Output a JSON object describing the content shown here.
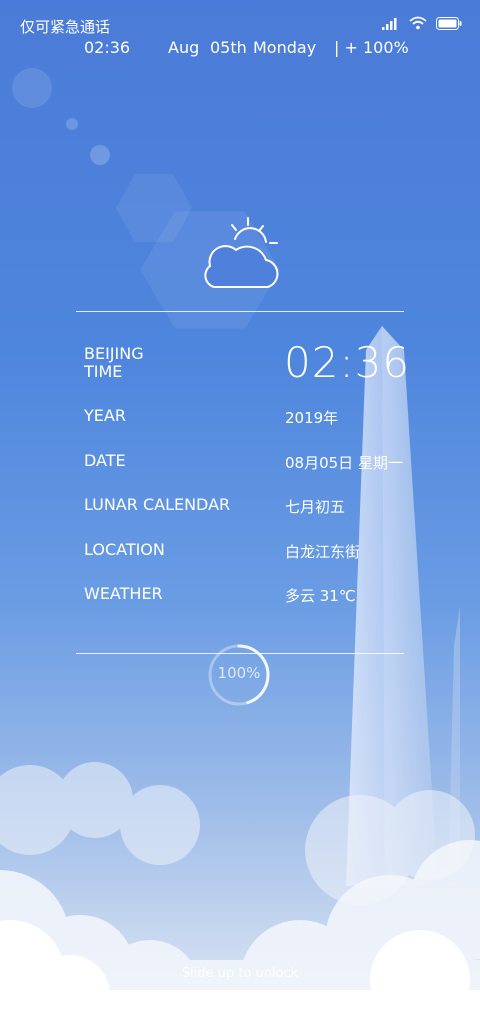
{
  "status_bar": {
    "carrier_text": "仅可紧急通话",
    "time": "02:36",
    "month": "Aug",
    "day": "05th",
    "weekday": "Monday",
    "battery_text": "| + 100%",
    "icons": [
      "signal-icon",
      "wifi-icon",
      "battery-icon"
    ]
  },
  "weather_icon": "partly-cloudy-icon",
  "info": {
    "rows": [
      {
        "label_line1": "BEIJING",
        "label_line2": "TIME",
        "value": "02:36"
      },
      {
        "label": "YEAR",
        "value": "2019年"
      },
      {
        "label": "DATE",
        "value": "08月05日 星期一"
      },
      {
        "label": "LUNAR CALENDAR",
        "value": "七月初五"
      },
      {
        "label": "LOCATION",
        "value": "白龙江东街"
      },
      {
        "label": "WEATHER",
        "value": "多云  31℃"
      }
    ]
  },
  "progress": {
    "label": "100%",
    "value": 1.0
  },
  "unlock_hint": "Slide up to unlock",
  "colors": {
    "sky_top": "#4a7bd8",
    "sky_bottom": "#dfe7f3",
    "text": "#ffffff"
  }
}
